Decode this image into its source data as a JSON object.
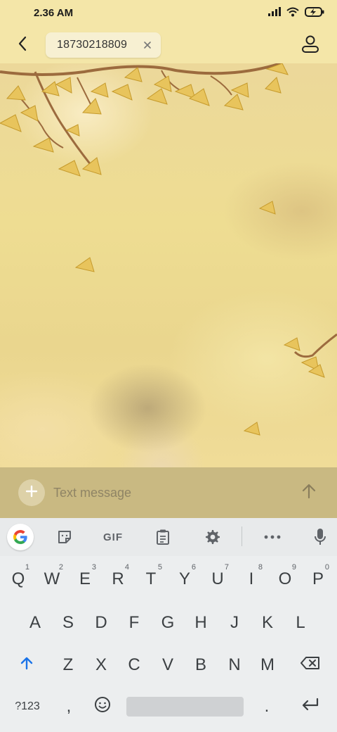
{
  "status_bar": {
    "time": "2.36 AM",
    "icons": [
      "signal-icon",
      "wifi-icon",
      "battery-charging-icon"
    ]
  },
  "header": {
    "back_icon": "chevron-left-icon",
    "recipient": "18730218809",
    "chip_close_icon": "close-icon",
    "contact_icon": "person-icon"
  },
  "compose": {
    "attach_icon": "plus-icon",
    "placeholder": "Text message",
    "send_icon": "arrow-up-icon"
  },
  "keyboard": {
    "toolbar": {
      "google_icon": "google-g-icon",
      "sticker_icon": "sticker-icon",
      "gif_label": "GIF",
      "clipboard_icon": "clipboard-icon",
      "settings_icon": "gear-icon",
      "more_icon": "more-dots-icon",
      "mic_icon": "microphone-icon"
    },
    "rows": [
      [
        {
          "label": "Q",
          "hint": "1"
        },
        {
          "label": "W",
          "hint": "2"
        },
        {
          "label": "E",
          "hint": "3"
        },
        {
          "label": "R",
          "hint": "4"
        },
        {
          "label": "T",
          "hint": "5"
        },
        {
          "label": "Y",
          "hint": "6"
        },
        {
          "label": "U",
          "hint": "7"
        },
        {
          "label": "I",
          "hint": "8"
        },
        {
          "label": "O",
          "hint": "9"
        },
        {
          "label": "P",
          "hint": "0"
        }
      ],
      [
        {
          "label": "A"
        },
        {
          "label": "S"
        },
        {
          "label": "D"
        },
        {
          "label": "F"
        },
        {
          "label": "G"
        },
        {
          "label": "H"
        },
        {
          "label": "J"
        },
        {
          "label": "K"
        },
        {
          "label": "L"
        }
      ],
      [
        {
          "label": "Z"
        },
        {
          "label": "X"
        },
        {
          "label": "C"
        },
        {
          "label": "V"
        },
        {
          "label": "B"
        },
        {
          "label": "N"
        },
        {
          "label": "M"
        }
      ]
    ],
    "shift_icon": "shift-arrow-icon",
    "backspace_icon": "backspace-icon",
    "symbols_label": "?123",
    "comma_label": ",",
    "emoji_icon": "emoji-icon",
    "period_label": ".",
    "enter_icon": "enter-icon"
  },
  "colors": {
    "header_bg": "#f4e6a8",
    "compose_bg": "#c9b982",
    "keyboard_bg": "#eceeef",
    "accent_blue": "#1a73e8"
  }
}
